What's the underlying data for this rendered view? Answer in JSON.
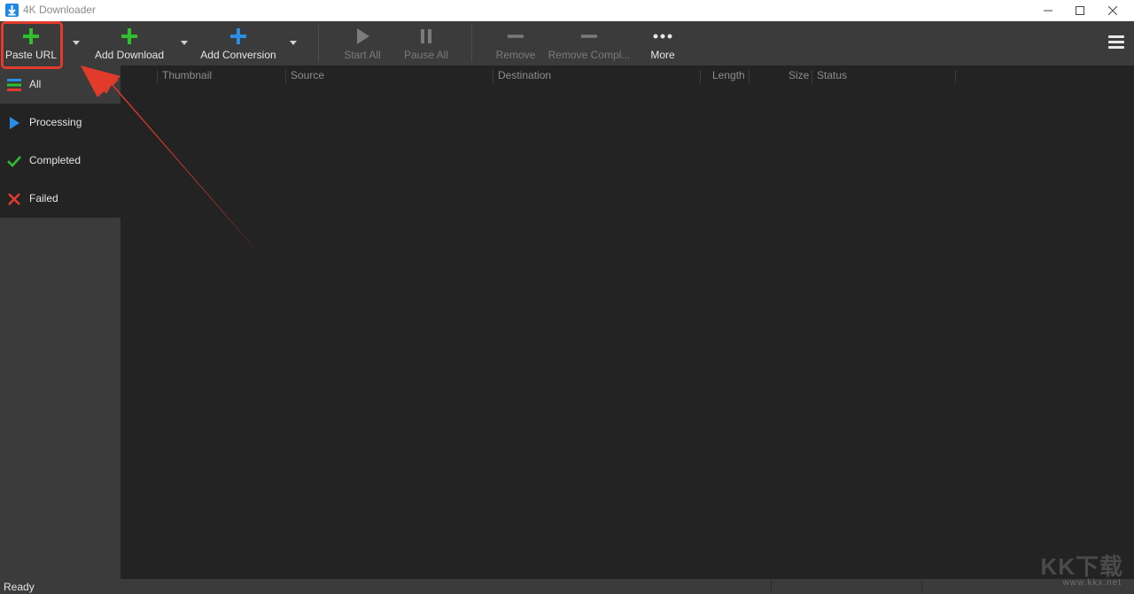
{
  "window": {
    "title": "4K Downloader",
    "controls": [
      "minimize-icon",
      "maximize-icon",
      "close-icon"
    ]
  },
  "toolbar": {
    "paste_url": "Paste URL",
    "add_download": "Add Download",
    "add_conversion": "Add Conversion",
    "start_all": "Start All",
    "pause_all": "Pause All",
    "remove": "Remove",
    "remove_completed": "Remove Compl...",
    "more": "More"
  },
  "sidebar": {
    "items": [
      {
        "label": "All",
        "icon": "list-icon"
      },
      {
        "label": "Processing",
        "icon": "play-icon"
      },
      {
        "label": "Completed",
        "icon": "check-icon"
      },
      {
        "label": "Failed",
        "icon": "x-icon"
      }
    ]
  },
  "table": {
    "columns": [
      "Thumbnail",
      "Source",
      "Destination",
      "Length",
      "Size",
      "Status"
    ],
    "rows": []
  },
  "status": {
    "text": "Ready"
  },
  "watermark": {
    "main": "KK下载",
    "sub": "www.kkx.net"
  },
  "colors": {
    "accent_green": "#2fbf2f",
    "accent_blue": "#2a8de8",
    "highlight_red": "#e23b2c",
    "background": "#232323",
    "panel": "#3b3b3b"
  }
}
